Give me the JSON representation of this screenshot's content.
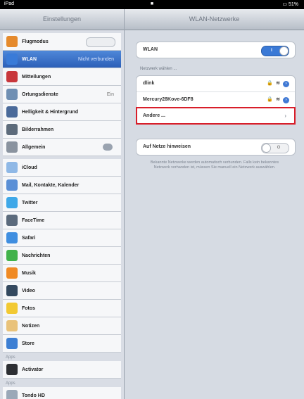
{
  "status": {
    "left": "iPad",
    "center": "■",
    "right": "▭ 51%"
  },
  "sidebar": {
    "title": "Einstellungen",
    "group1": [
      {
        "label": "Flugmodus",
        "icon": "airplane-icon",
        "color": "#e58a2d",
        "control": "toggle"
      },
      {
        "label": "WLAN",
        "icon": "wifi-icon",
        "color": "#3a7bd8",
        "value": "Nicht verbunden",
        "selected": true
      },
      {
        "label": "Mitteilungen",
        "icon": "notifications-icon",
        "color": "#c8373c"
      },
      {
        "label": "Ortungsdienste",
        "icon": "location-icon",
        "color": "#6f8fb3",
        "value": "Ein"
      },
      {
        "label": "Helligkeit & Hintergrund",
        "icon": "brightness-icon",
        "color": "#4a6a9a"
      },
      {
        "label": "Bilderrahmen",
        "icon": "picture-frame-icon",
        "color": "#5d6b7b"
      },
      {
        "label": "Allgemein",
        "icon": "gear-icon",
        "color": "#8a939f",
        "badge": true
      }
    ],
    "group2": [
      {
        "label": "iCloud",
        "icon": "cloud-icon",
        "color": "#8fb8e6"
      },
      {
        "label": "Mail, Kontakte, Kalender",
        "icon": "mail-icon",
        "color": "#5a8fd6"
      },
      {
        "label": "Twitter",
        "icon": "twitter-icon",
        "color": "#3fa8e8"
      },
      {
        "label": "FaceTime",
        "icon": "facetime-icon",
        "color": "#5b6a7c"
      },
      {
        "label": "Safari",
        "icon": "safari-icon",
        "color": "#3f8ee0"
      },
      {
        "label": "Nachrichten",
        "icon": "messages-icon",
        "color": "#41b24b"
      },
      {
        "label": "Musik",
        "icon": "music-icon",
        "color": "#f08a24"
      },
      {
        "label": "Video",
        "icon": "video-icon",
        "color": "#34495f"
      },
      {
        "label": "Fotos",
        "icon": "photos-icon",
        "color": "#f2c933"
      },
      {
        "label": "Notizen",
        "icon": "notes-icon",
        "color": "#e9c27a"
      },
      {
        "label": "Store",
        "icon": "store-icon",
        "color": "#3d7fd3"
      }
    ],
    "section_apps": "Apps",
    "group3": [
      {
        "label": "Activator",
        "icon": "activator-icon",
        "color": "#2d2f33"
      }
    ],
    "section_more": "Apps",
    "group4": [
      {
        "label": "Tondo HD",
        "icon": "tondo-icon",
        "color": "#9aa8b8"
      }
    ]
  },
  "detail": {
    "title": "WLAN-Netzwerke",
    "wlan_label": "WLAN",
    "wlan_toggle": "I",
    "choose_label": "Netzwerk wählen ...",
    "networks": [
      {
        "name": "dlink"
      },
      {
        "name": "Mercury28Kove-6DF8"
      }
    ],
    "other_label": "Andere ...",
    "ask_label": "Auf Netze hinweisen",
    "ask_toggle": "O",
    "note": "Bekannte Netzwerke werden automatisch verbunden. Falls kein bekanntes Netzwerk vorhanden ist, müssen Sie manuell ein Netzwerk auswählen."
  }
}
